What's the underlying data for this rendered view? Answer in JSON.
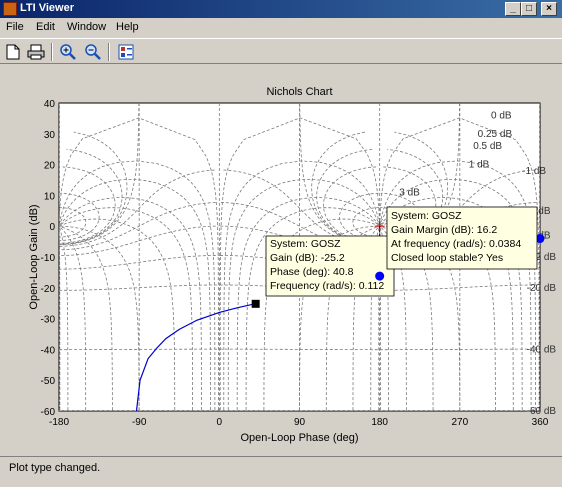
{
  "window": {
    "title": "LTI Viewer",
    "minimize_glyph": "_",
    "maximize_glyph": "□",
    "close_glyph": "×"
  },
  "menu": {
    "items": [
      "File",
      "Edit",
      "Window",
      "Help"
    ]
  },
  "toolbar": {
    "tools": [
      "new-figure-icon",
      "print-icon",
      "zoom-in-icon",
      "zoom-out-icon",
      "plot-config-icon"
    ]
  },
  "chart_data": {
    "type": "line",
    "title": "Nichols Chart",
    "xlabel": "Open-Loop Phase (deg)",
    "ylabel": "Open-Loop Gain (dB)",
    "xlim": [
      -180,
      360
    ],
    "ylim": [
      -60,
      40
    ],
    "xticks": [
      "-180",
      "-90",
      "0",
      "90",
      "180",
      "270",
      "360"
    ],
    "yticks": [
      "40",
      "30",
      "20",
      "10",
      "0",
      "-10",
      "-20",
      "-30",
      "-40",
      "-50",
      "-60"
    ],
    "grid": true,
    "grid_labels": [
      {
        "text": "0 dB",
        "x": 305,
        "y": 36
      },
      {
        "text": "0.25 dB",
        "x": 290,
        "y": 30
      },
      {
        "text": "0.5 dB",
        "x": 285,
        "y": 26
      },
      {
        "text": "1 dB",
        "x": 280,
        "y": 20
      },
      {
        "text": "-1 dB",
        "x": 340,
        "y": 18
      },
      {
        "text": "3 dB",
        "x": 202,
        "y": 11
      },
      {
        "text": "6 dB",
        "x": 200,
        "y": 5
      },
      {
        "text": "-3 dB",
        "x": 345,
        "y": 5
      },
      {
        "text": "-6 dB",
        "x": 345,
        "y": -3
      },
      {
        "text": "-12 dB",
        "x": 345,
        "y": -10
      },
      {
        "text": "-20 dB",
        "x": 345,
        "y": -20
      },
      {
        "text": "-40 dB",
        "x": 345,
        "y": -40
      },
      {
        "text": "-60 dB",
        "x": 345,
        "y": -60
      }
    ],
    "series": [
      {
        "system": "GOSZ",
        "color": "#0000cc",
        "x": [
          -93,
          -89,
          -80,
          -70,
          -60,
          -45,
          -25,
          0,
          20,
          40
        ],
        "y": [
          -60,
          -50,
          -43,
          -39.5,
          -36.5,
          -33.5,
          -30.5,
          -28,
          -26.5,
          -25.2
        ]
      }
    ],
    "datatips": [
      {
        "system": "GOSZ",
        "marker": "square",
        "x": 40.8,
        "y": -25.2,
        "lines": [
          "System: GOSZ",
          "Gain (dB): -25.2",
          "Phase (deg): 40.8",
          "Frequency (rad/s): 0.112"
        ]
      },
      {
        "system": "GOSZ",
        "marker": "circle",
        "x": 180,
        "y": -16.2,
        "lines": [
          "System: GOSZ",
          "Gain Margin (dB): 16.2",
          "At frequency (rad/s): 0.0384",
          "Closed loop stable? Yes"
        ]
      }
    ],
    "edge_marker": {
      "x": 360,
      "y": -4
    },
    "critical_point": {
      "x": 180,
      "y": 0
    }
  },
  "status": {
    "text": "Plot type changed."
  }
}
